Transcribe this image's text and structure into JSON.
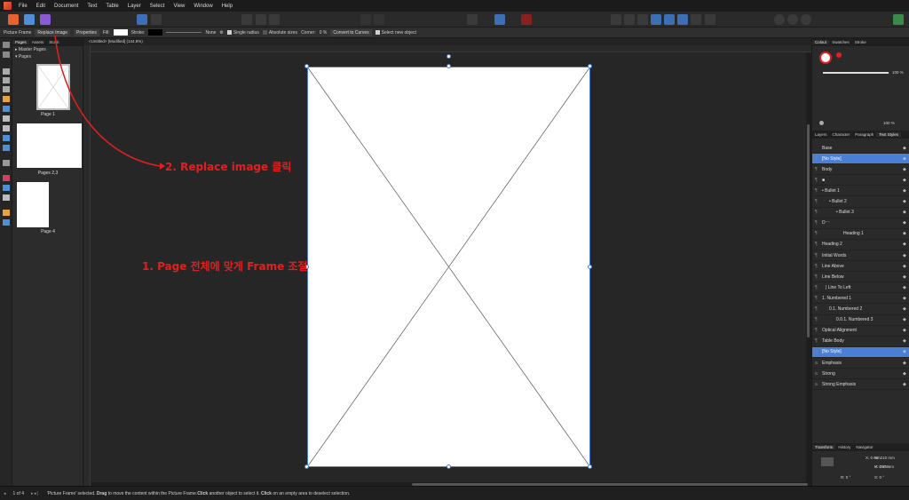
{
  "menu": [
    "File",
    "Edit",
    "Document",
    "Text",
    "Table",
    "Layer",
    "Select",
    "View",
    "Window",
    "Help"
  ],
  "context": {
    "mode": "Picture Frame",
    "replace_image": "Replace Image",
    "properties": "Properties",
    "fill": "Fill:",
    "stroke": "Stroke:",
    "stroke_value": "None",
    "single_radius": "Single radius",
    "absolute_sizes": "Absolute sizes",
    "corner": "Corner:",
    "corner_value": "0 %",
    "convert_to_curves": "Convert to Curves",
    "select_new_object": "Select new object"
  },
  "pages_panel": {
    "tabs": [
      "Pages",
      "Assets",
      "Stock"
    ],
    "master_pages": "Master Pages",
    "pages": "Pages",
    "thumbs": [
      "Page 1",
      "Pages 2,3",
      "Page 4"
    ]
  },
  "document_tab": "<Untitled> [Modified] (144.8%)",
  "annotations": {
    "step1": "1. Page 전체에 맞게 Frame 조절",
    "step2": "2. Replace image 클릭"
  },
  "right_panel": {
    "top_tabs": [
      "Colour",
      "Swatches",
      "Stroke"
    ],
    "opacity": "100 %",
    "opacity2": "100 %",
    "mid_tabs": [
      "Layers",
      "Character",
      "Paragraph",
      "Text Styles"
    ],
    "styles": [
      {
        "name": "Base",
        "sel": false,
        "indent": 0,
        "marker": ""
      },
      {
        "name": "[No Style]",
        "sel": true,
        "indent": 0,
        "marker": "¶"
      },
      {
        "name": "Body",
        "sel": false,
        "indent": 0,
        "marker": "¶"
      },
      {
        "name": "■",
        "sel": false,
        "indent": 0,
        "marker": "¶"
      },
      {
        "name": "•   Bullet 1",
        "sel": false,
        "indent": 0,
        "marker": "¶"
      },
      {
        "name": "•   Bullet 2",
        "sel": false,
        "indent": 8,
        "marker": "¶"
      },
      {
        "name": "•   Bullet 3",
        "sel": false,
        "indent": 16,
        "marker": "¶"
      },
      {
        "name": "D⁻⁻",
        "sel": false,
        "indent": 0,
        "marker": "¶"
      },
      {
        "name": "Heading 1",
        "sel": false,
        "indent": 24,
        "marker": "¶"
      },
      {
        "name": "Heading 2",
        "sel": false,
        "indent": 0,
        "marker": "¶"
      },
      {
        "name": "Initial Words",
        "sel": false,
        "indent": 0,
        "marker": "¶"
      },
      {
        "name": "Line Above",
        "sel": false,
        "indent": 0,
        "marker": "¶"
      },
      {
        "name": "Line Below",
        "sel": false,
        "indent": 0,
        "marker": "¶"
      },
      {
        "name": "|   Line To Left",
        "sel": false,
        "indent": 4,
        "marker": "¶"
      },
      {
        "name": "1.   Numbered 1",
        "sel": false,
        "indent": 0,
        "marker": "¶"
      },
      {
        "name": "0.1.   Numbered 2",
        "sel": false,
        "indent": 8,
        "marker": "¶"
      },
      {
        "name": "0.0.1.   Numbered 3",
        "sel": false,
        "indent": 16,
        "marker": "¶"
      },
      {
        "name": "Optical Alignment",
        "sel": false,
        "indent": 0,
        "marker": "¶"
      },
      {
        "name": "Table Body",
        "sel": false,
        "indent": 0,
        "marker": "¶"
      },
      {
        "name": "[No Style]",
        "sel": true,
        "indent": 0,
        "marker": "a"
      },
      {
        "name": "Emphasis",
        "sel": false,
        "indent": 0,
        "marker": "a"
      },
      {
        "name": "Strong",
        "sel": false,
        "indent": 0,
        "marker": "a"
      },
      {
        "name": "Strong Emphasis",
        "sel": false,
        "indent": 0,
        "marker": "a"
      }
    ],
    "bottom_tabs": [
      "Transform",
      "History",
      "Navigator"
    ],
    "transform": {
      "x": "0 mm",
      "y": "0 mm",
      "w": "210 mm",
      "h": "297 mm",
      "r": "0 °",
      "s": "0 °"
    }
  },
  "status": {
    "page_indicator": "1 of 4",
    "message_prefix": "'Picture Frame' selected. ",
    "drag": "Drag",
    "message_mid": " to move the content within the Picture Frame.",
    "click1": "Click",
    "message_mid2": " another object to select it. ",
    "click2": "Click",
    "message_end": " on an empty area to deselect selection."
  },
  "colors": {
    "accent": "#4a7fd4",
    "annotation": "#e02020"
  }
}
